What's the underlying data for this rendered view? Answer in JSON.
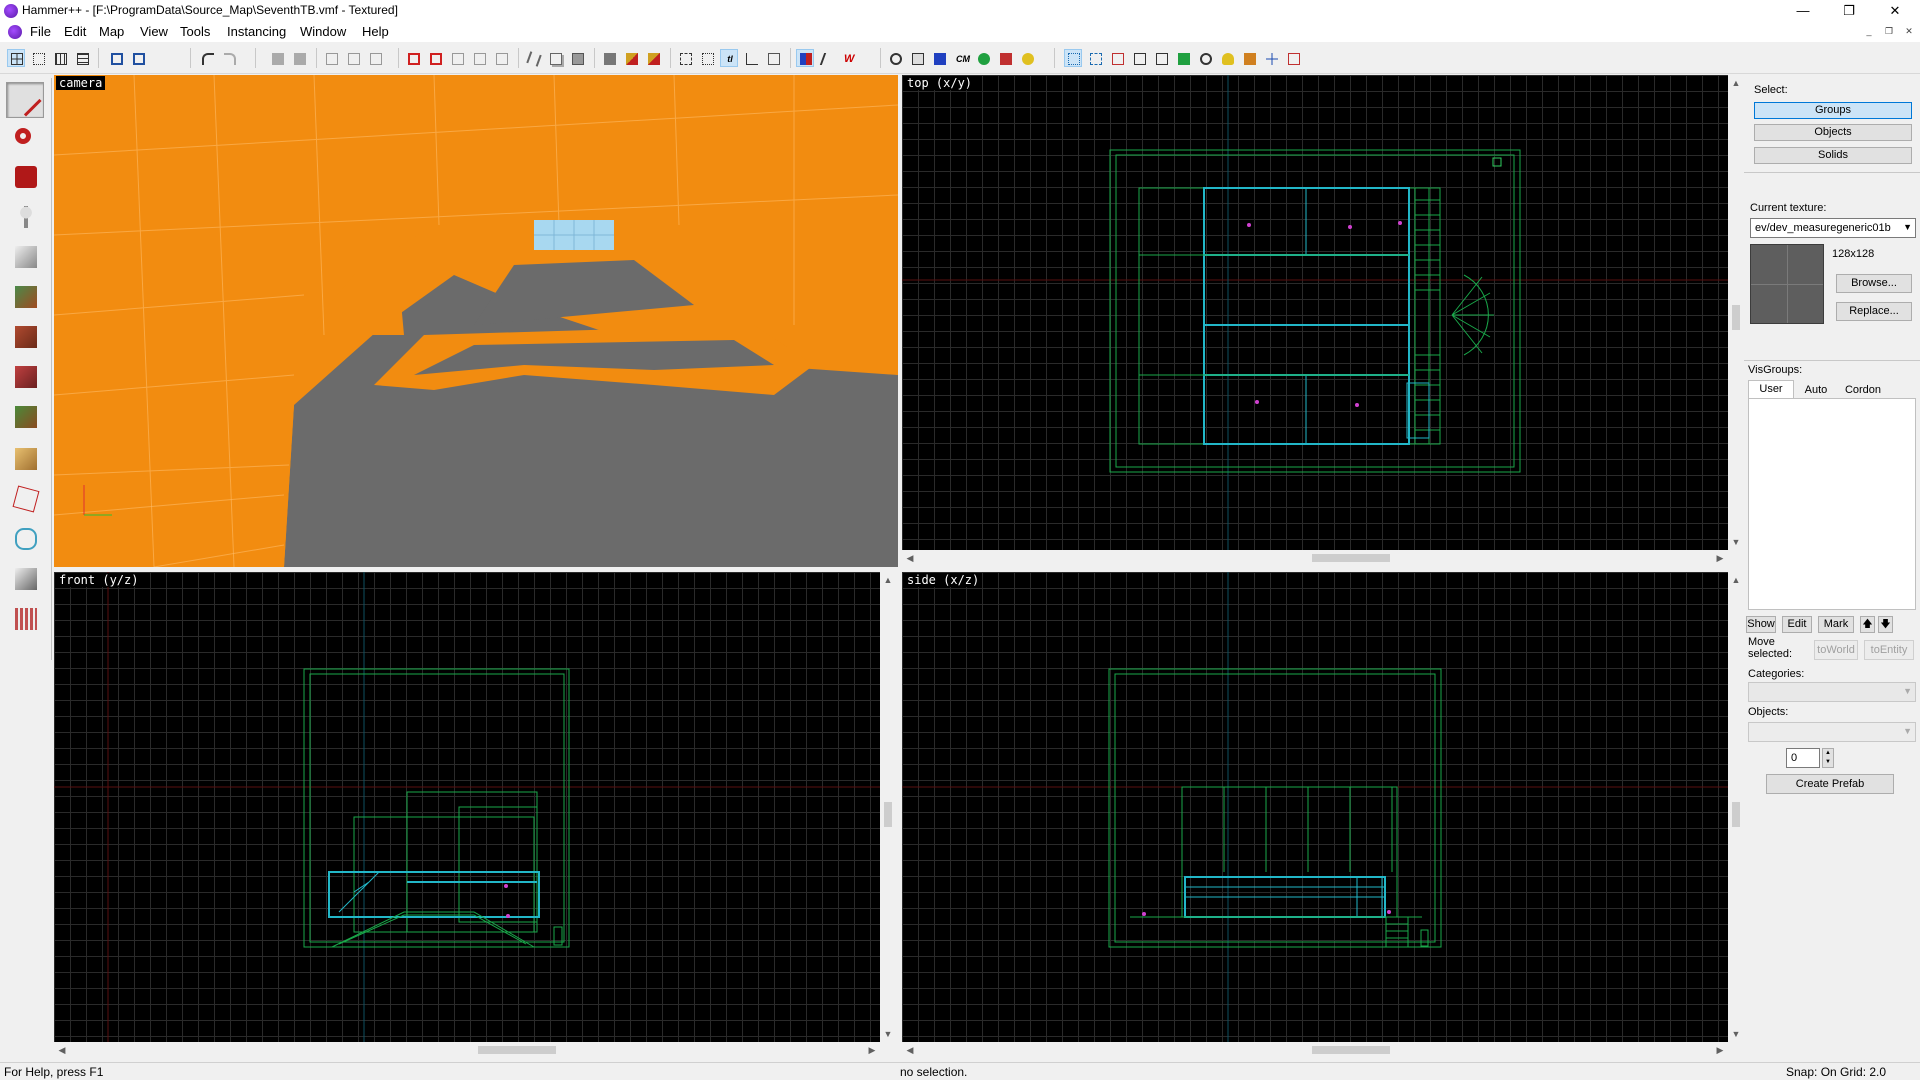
{
  "window": {
    "title": "Hammer++ - [F:\\ProgramData\\Source_Map\\SeventhTB.vmf - Textured]",
    "minimize": "—",
    "maximize": "❐",
    "close": "✕"
  },
  "menu": {
    "items": [
      "File",
      "Edit",
      "Map",
      "View",
      "Tools",
      "Instancing",
      "Window",
      "Help"
    ]
  },
  "toolbar": {
    "cm_label": "CM"
  },
  "viewports": {
    "camera": {
      "label": "camera",
      "wall_color": "#f28c10",
      "floor_color": "#6b6b6b"
    },
    "top": {
      "label": "top (x/y)"
    },
    "front": {
      "label": "front (y/z)"
    },
    "side": {
      "label": "side (x/z)"
    }
  },
  "right_panel": {
    "select_label": "Select:",
    "select_buttons": [
      "Groups",
      "Objects",
      "Solids"
    ],
    "current_texture_label": "Current texture:",
    "texture_name": "ev/dev_measuregeneric01b",
    "texture_size": "128x128",
    "browse": "Browse...",
    "replace": "Replace...",
    "visgroups_label": "VisGroups:",
    "visgroup_tabs": [
      "User",
      "Auto",
      "Cordon"
    ],
    "show": "Show",
    "edit": "Edit",
    "mark": "Mark",
    "up_arrow": "🡅",
    "down_arrow": "🡇",
    "move_selected": "Move selected:",
    "to_world": "toWorld",
    "to_entity": "toEntity",
    "categories_label": "Categories:",
    "objects_label": "Objects:",
    "spin_value": "0",
    "create_prefab": "Create Prefab"
  },
  "status": {
    "help": "For Help, press F1",
    "selection": "no selection.",
    "snap": "Snap: On Grid: 2.0"
  },
  "colors": {
    "grid_line": "#2a2a2a",
    "brush_green": "#1aa84a",
    "brush_cyan": "#22b7c8",
    "axis_red": "#5a1010",
    "axis_blue": "#0e5060"
  }
}
